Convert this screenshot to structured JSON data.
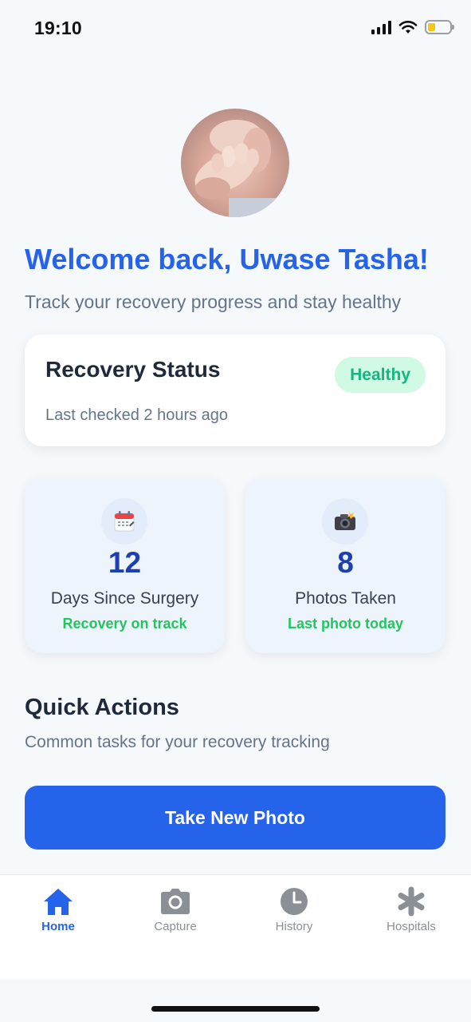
{
  "status_bar": {
    "time": "19:10",
    "icons": [
      "cellular-signal-icon",
      "wifi-icon",
      "battery-low-icon"
    ],
    "battery_color": "#f5c518"
  },
  "profile": {
    "avatar": "avatar-photo-baby-hand"
  },
  "header": {
    "welcome": "Welcome back, Uwase Tasha!",
    "subtitle": "Track your recovery progress and stay healthy"
  },
  "recovery_status": {
    "title": "Recovery Status",
    "badge": "Healthy",
    "last_checked": "Last checked 2 hours ago"
  },
  "stats": [
    {
      "icon": "calendar-icon",
      "value": "12",
      "label": "Days Since Surgery",
      "note": "Recovery on track"
    },
    {
      "icon": "camera-flash-icon",
      "value": "8",
      "label": "Photos Taken",
      "note": "Last photo today"
    }
  ],
  "quick_actions": {
    "title": "Quick Actions",
    "subtitle": "Common tasks for your recovery tracking",
    "primary_button": "Take New Photo"
  },
  "tab_bar": {
    "active": "Home",
    "tabs": [
      {
        "label": "Home",
        "icon": "home-icon"
      },
      {
        "label": "Capture",
        "icon": "camera-icon"
      },
      {
        "label": "History",
        "icon": "clock-icon"
      },
      {
        "label": "Hospitals",
        "icon": "asterisk-icon"
      }
    ]
  },
  "colors": {
    "primary": "#2563eb",
    "success": "#10b981",
    "success_bg": "#d1fae5",
    "stat_value": "#1e40af"
  }
}
